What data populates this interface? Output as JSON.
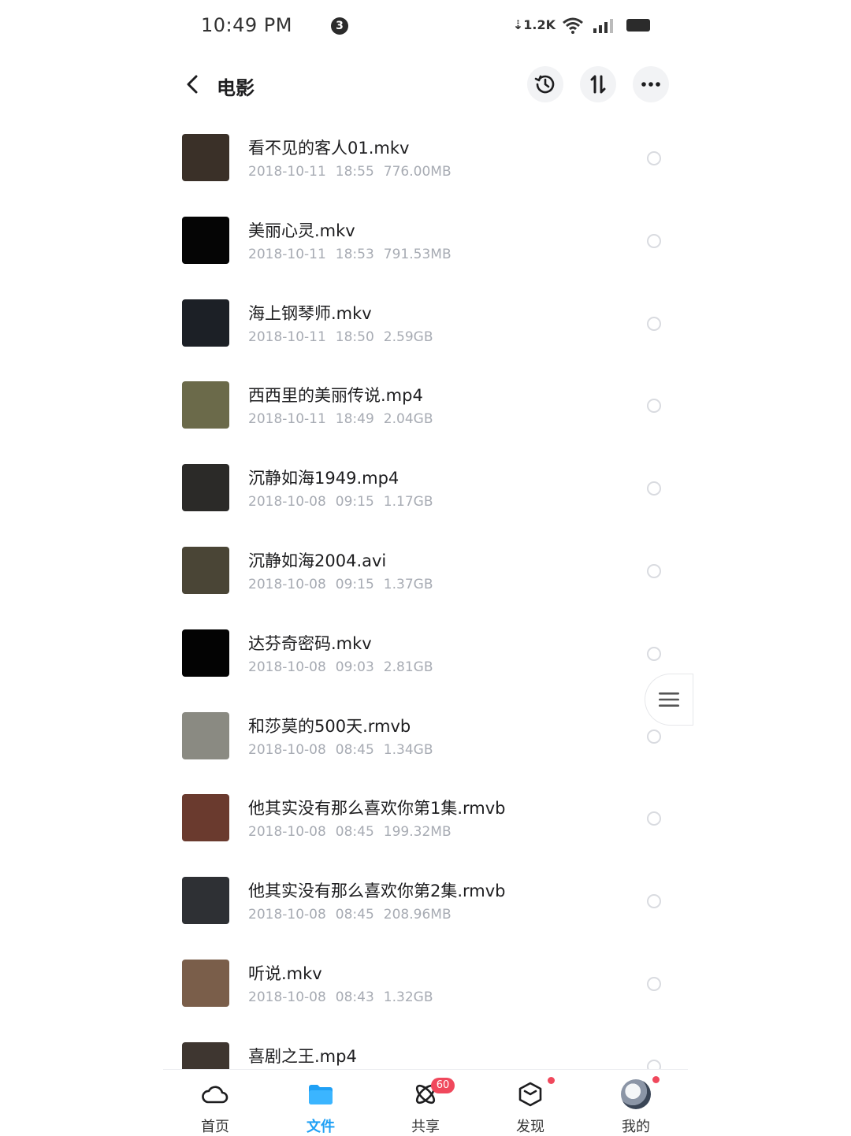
{
  "status_bar": {
    "time": "10:49 PM",
    "notification_count": "3",
    "net_speed": "⇣1.2K"
  },
  "header": {
    "title": "电影"
  },
  "files": [
    {
      "name": "看不见的客人01.mkv",
      "date": "2018-10-11",
      "time": "18:55",
      "size": "776.00MB",
      "thumb": "#3a3028"
    },
    {
      "name": "美丽心灵.mkv",
      "date": "2018-10-11",
      "time": "18:53",
      "size": "791.53MB",
      "thumb": "#050505"
    },
    {
      "name": "海上钢琴师.mkv",
      "date": "2018-10-11",
      "time": "18:50",
      "size": "2.59GB",
      "thumb": "#1c2026"
    },
    {
      "name": "西西里的美丽传说.mp4",
      "date": "2018-10-11",
      "time": "18:49",
      "size": "2.04GB",
      "thumb": "#6b6a4a"
    },
    {
      "name": "沉静如海1949.mp4",
      "date": "2018-10-08",
      "time": "09:15",
      "size": "1.17GB",
      "thumb": "#2b2a28"
    },
    {
      "name": "沉静如海2004.avi",
      "date": "2018-10-08",
      "time": "09:15",
      "size": "1.37GB",
      "thumb": "#4a4536"
    },
    {
      "name": "达芬奇密码.mkv",
      "date": "2018-10-08",
      "time": "09:03",
      "size": "2.81GB",
      "thumb": "#030303"
    },
    {
      "name": "和莎莫的500天.rmvb",
      "date": "2018-10-08",
      "time": "08:45",
      "size": "1.34GB",
      "thumb": "#8a8a82"
    },
    {
      "name": "他其实没有那么喜欢你第1集.rmvb",
      "date": "2018-10-08",
      "time": "08:45",
      "size": "199.32MB",
      "thumb": "#6a3a2e"
    },
    {
      "name": "他其实没有那么喜欢你第2集.rmvb",
      "date": "2018-10-08",
      "time": "08:45",
      "size": "208.96MB",
      "thumb": "#2e3034"
    },
    {
      "name": "听说.mkv",
      "date": "2018-10-08",
      "time": "08:43",
      "size": "1.32GB",
      "thumb": "#7a5e4a"
    },
    {
      "name": "喜剧之王.mp4",
      "date": "",
      "time": "",
      "size": "",
      "thumb": "#3e3630"
    }
  ],
  "tabbar": {
    "tabs": [
      {
        "label": "首页",
        "icon": "cloud-icon"
      },
      {
        "label": "文件",
        "icon": "folder-icon"
      },
      {
        "label": "共享",
        "icon": "atom-icon",
        "badge": "60"
      },
      {
        "label": "发现",
        "icon": "cube-icon"
      },
      {
        "label": "我的",
        "icon": "avatar"
      }
    ]
  },
  "colors": {
    "accent": "#1fa0f5",
    "badge": "#f0485c",
    "meta_text": "#a7abb3"
  }
}
